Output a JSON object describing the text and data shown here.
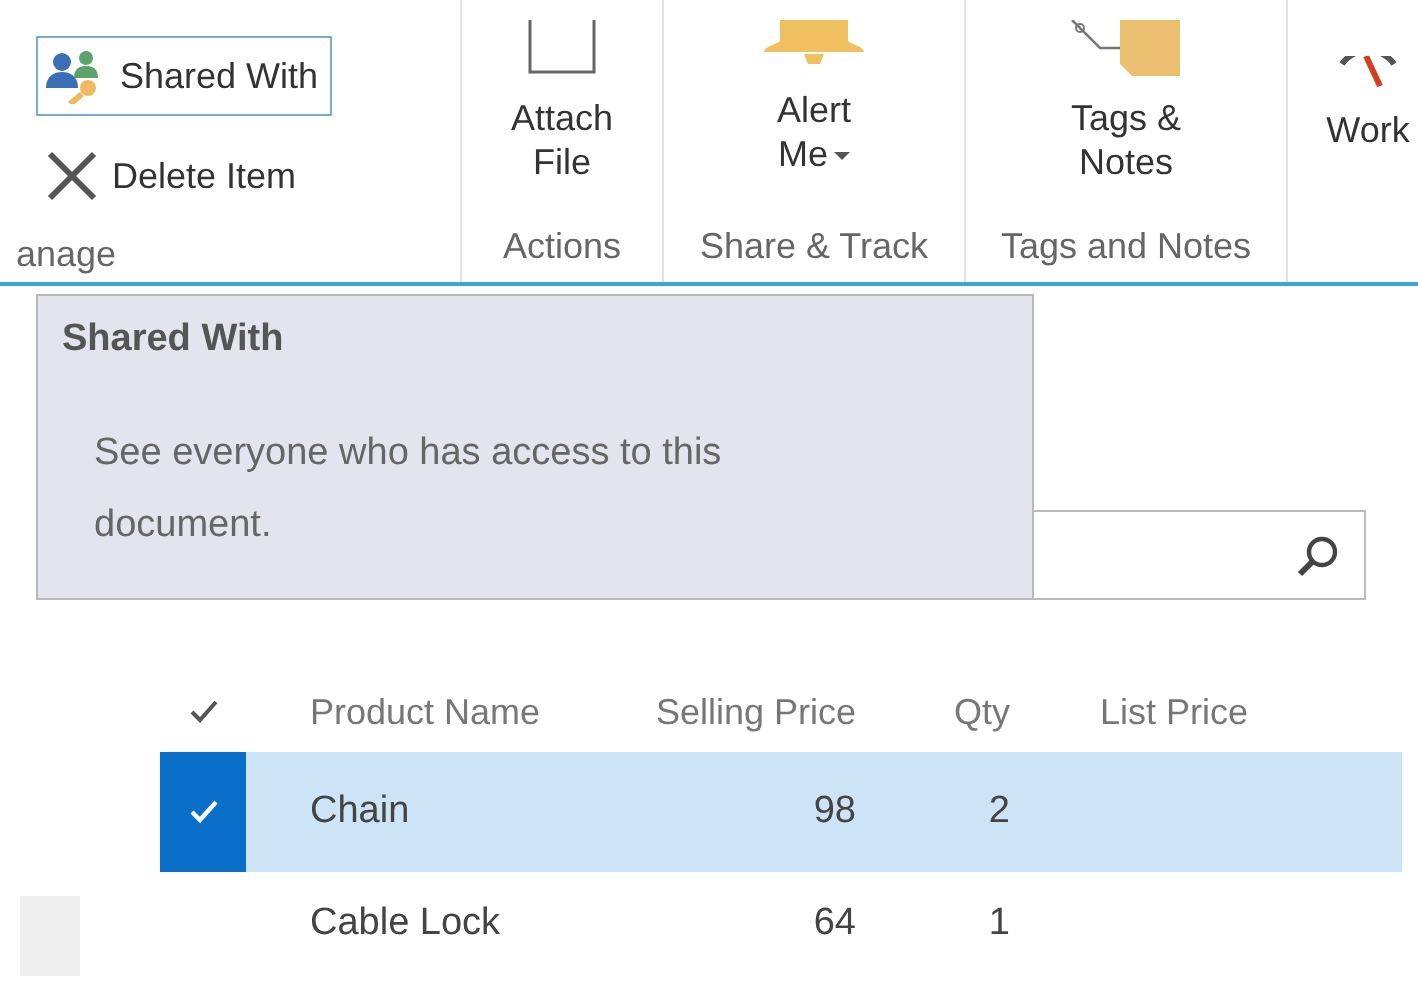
{
  "ribbon": {
    "groups": [
      {
        "kind": "small",
        "label": "anage",
        "buttons": [
          {
            "label": "Shared With",
            "highlighted": true
          },
          {
            "label": "Delete Item",
            "highlighted": false
          }
        ]
      },
      {
        "kind": "large",
        "label": "Actions",
        "buttons": [
          {
            "lines": [
              "Attach",
              "File"
            ],
            "dropdown": false
          }
        ]
      },
      {
        "kind": "large",
        "label": "Share & Track",
        "buttons": [
          {
            "lines": [
              "Alert",
              "Me"
            ],
            "dropdown": true
          }
        ]
      },
      {
        "kind": "large",
        "label": "Tags and Notes",
        "buttons": [
          {
            "lines": [
              "Tags &",
              "Notes"
            ],
            "dropdown": false
          }
        ]
      },
      {
        "kind": "large",
        "buttons": [
          {
            "lines": [
              "Work"
            ],
            "dropdown": false
          }
        ]
      }
    ]
  },
  "tooltip": {
    "title": "Shared With",
    "description": "See everyone who has access to this document."
  },
  "list": {
    "columns": [
      "Product Name",
      "Selling Price",
      "Qty",
      "List Price"
    ],
    "rows": [
      {
        "selected": true,
        "cells": [
          "Chain",
          "98",
          "2"
        ]
      },
      {
        "selected": false,
        "cells": [
          "Cable Lock",
          "64",
          "1"
        ]
      }
    ]
  }
}
